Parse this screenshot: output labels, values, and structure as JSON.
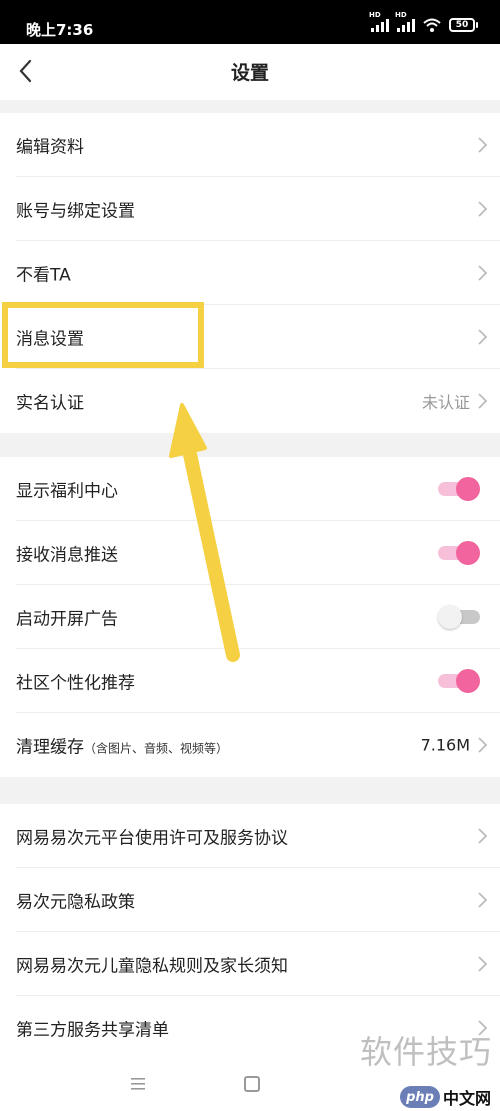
{
  "status_bar": {
    "time": "晚上7:36",
    "battery": "50",
    "signal_tag": "HD"
  },
  "header": {
    "title": "设置"
  },
  "section1": [
    {
      "label": "编辑资料"
    },
    {
      "label": "账号与绑定设置"
    },
    {
      "label": "不看TA"
    },
    {
      "label": "消息设置"
    },
    {
      "label": "实名认证",
      "value": "未认证"
    }
  ],
  "section2": [
    {
      "label": "显示福利中心",
      "toggle": true
    },
    {
      "label": "接收消息推送",
      "toggle": true
    },
    {
      "label": "启动开屏广告",
      "toggle": false
    },
    {
      "label": "社区个性化推荐",
      "toggle": true
    },
    {
      "label": "清理缓存",
      "sub": "（含图片、音频、视频等）",
      "value": "7.16M"
    }
  ],
  "section3": [
    {
      "label": "网易易次元平台使用许可及服务协议"
    },
    {
      "label": "易次元隐私政策"
    },
    {
      "label": "网易易次元儿童隐私规则及家长须知"
    },
    {
      "label": "第三方服务共享清单"
    }
  ],
  "watermark": {
    "text": "软件技巧",
    "logo_text": "php",
    "logo_suffix": "中文网"
  },
  "colors": {
    "accent_pink": "#f2649e",
    "highlight_yellow": "#f5d042"
  },
  "icons": {
    "back": "chevron-left-icon",
    "row_arrow": "chevron-right-icon"
  }
}
